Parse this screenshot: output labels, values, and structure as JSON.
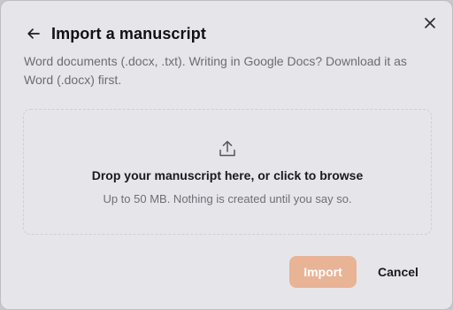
{
  "dialog": {
    "title": "Import a manuscript",
    "description": "Word documents (.docx, .txt). Writing in Google Docs? Download it as Word (.docx) first.",
    "icons": {
      "back": "arrow-left-icon",
      "close": "close-icon",
      "upload": "upload-icon"
    }
  },
  "dropzone": {
    "primary_text": "Drop your manuscript here, or click to browse",
    "secondary_text": "Up to 50 MB. Nothing is created until you say so."
  },
  "actions": {
    "import_label": "Import",
    "import_enabled": false,
    "cancel_label": "Cancel"
  },
  "colors": {
    "background": "#e6e6ea",
    "import_button_disabled": "#e9b396",
    "muted_text": "#6b6b72"
  }
}
